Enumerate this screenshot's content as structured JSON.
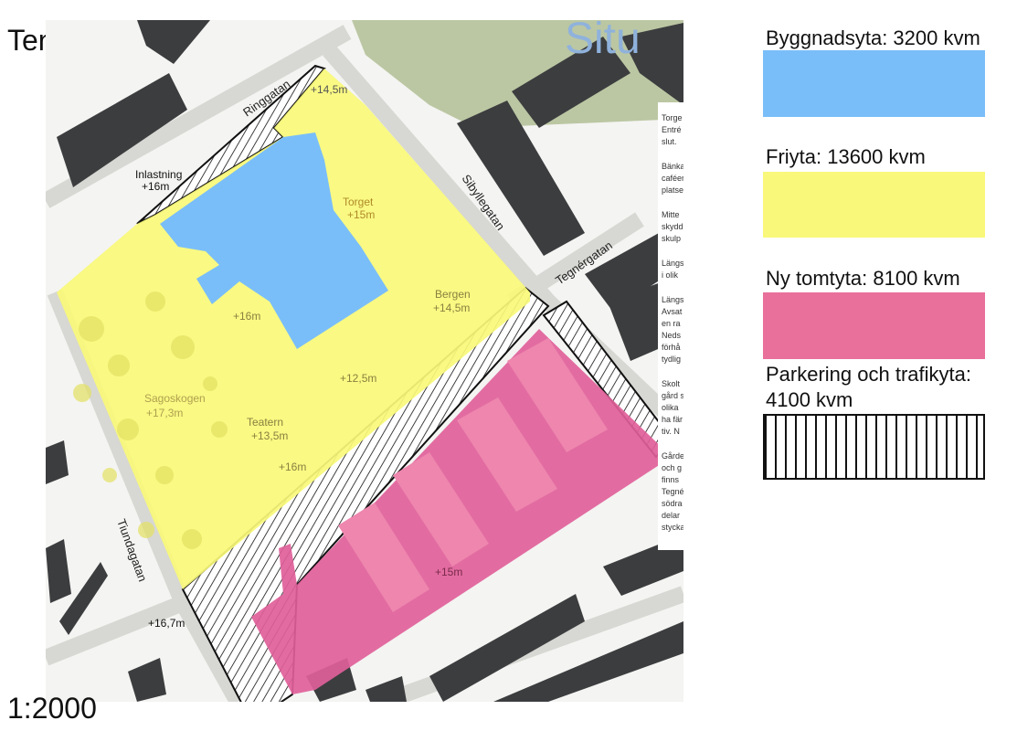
{
  "title": "Tengbom",
  "scale": "1:2000",
  "colors": {
    "building": "#7abef9",
    "open_space": "#f9f87a",
    "new_plot": "#e8709a",
    "hatch": "#111111"
  },
  "map": {
    "overlay_title": "Situ",
    "streets": {
      "ringgatan": "Ringgatan",
      "sibyllegatan": "Sibyllegatan",
      "tegnergatan": "Tegnérgatan",
      "tiundagatan": "Tiundagatan"
    },
    "labels": {
      "inlastning": "Inlastning",
      "inlastning_level": "+16m",
      "top_level": "+14,5m",
      "torget": "Torget",
      "torget_level": "+15m",
      "bergen": "Bergen",
      "bergen_level": "+14,5m",
      "center_level": "+16m",
      "mid_level": "+12,5m",
      "sagoskogen": "Sagoskogen",
      "sagoskogen_level": "+17,3m",
      "teatern": "Teatern",
      "teatern_level": "+13,5m",
      "south_level": "+16m",
      "plot_level": "+15m",
      "corner_level": "+16,7m"
    },
    "side_text": [
      "Torge",
      "Entré",
      "slut.",
      "Bänka",
      "caféer",
      "platse",
      "Mitte",
      "skydd",
      "skulp",
      "Längs",
      "i olik",
      "Längs",
      "Avsat",
      "en ra",
      "Neds",
      "förhå",
      "tydlig",
      "Skolt",
      "gård s",
      "olika",
      "ha fär",
      "tiv. N",
      "Gårde",
      "och g",
      "finns",
      "Tegné",
      "södra",
      "delar",
      "stycka"
    ]
  },
  "legend": [
    {
      "label": "Byggnadsyta: 3200 kvm",
      "color": "#7abef9",
      "kind": "fill"
    },
    {
      "label": "Friyta: 13600 kvm",
      "color": "#f9f87a",
      "kind": "fill"
    },
    {
      "label": "Ny tomtyta: 8100 kvm",
      "color": "#e8709a",
      "kind": "fill"
    },
    {
      "label": "Parkering och trafikyta:",
      "label_line2": "4100 kvm",
      "kind": "hatch"
    }
  ]
}
